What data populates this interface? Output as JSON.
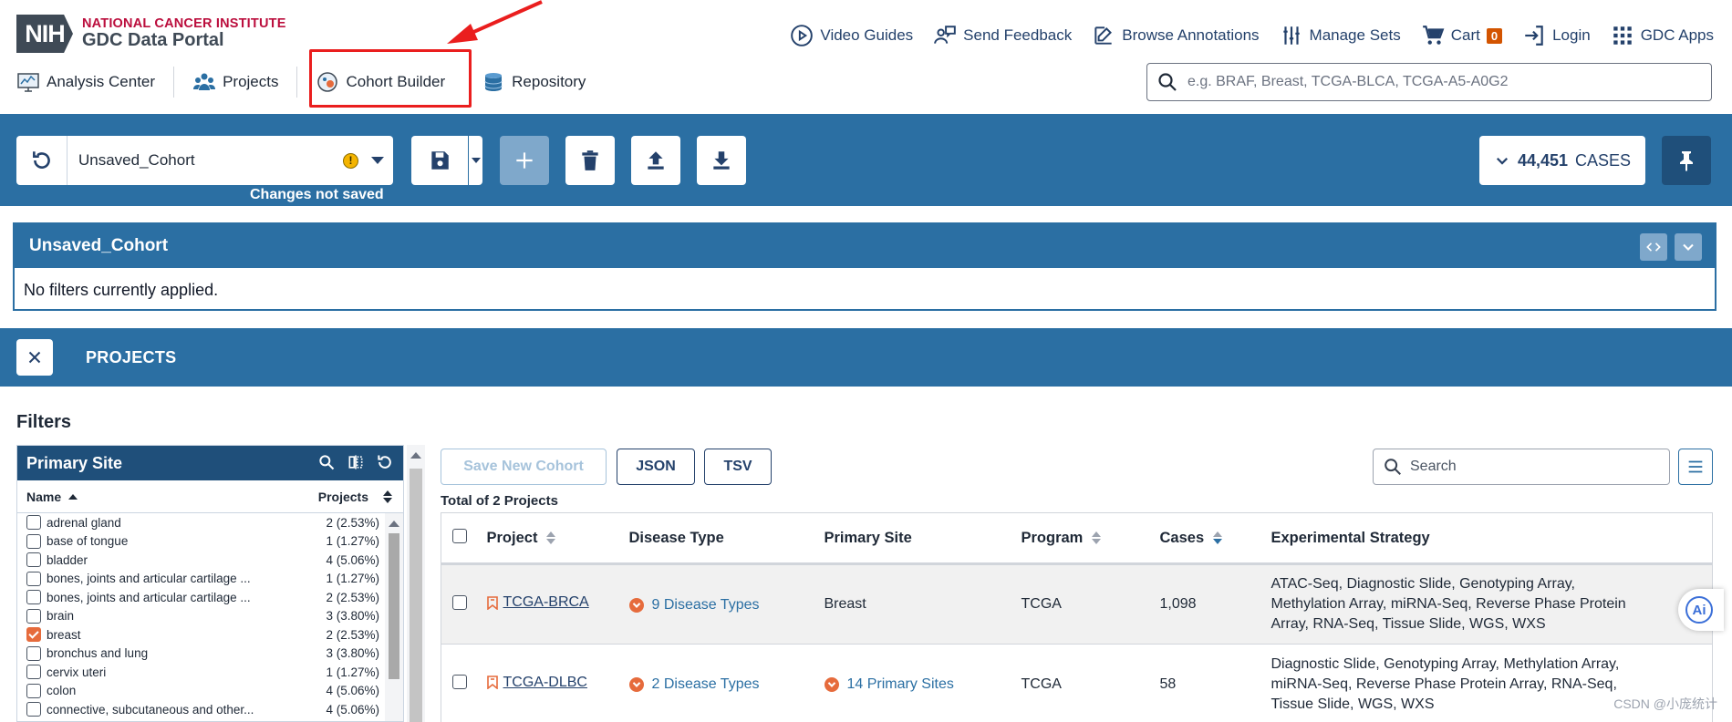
{
  "logo": {
    "badge": "NIH",
    "institute": "NATIONAL CANCER INSTITUTE",
    "portal": "GDC Data Portal"
  },
  "top_links": [
    {
      "label": "Video Guides",
      "icon": "play-circle-icon"
    },
    {
      "label": "Send Feedback",
      "icon": "feedback-icon"
    },
    {
      "label": "Browse Annotations",
      "icon": "edit-icon"
    },
    {
      "label": "Manage Sets",
      "icon": "sliders-icon"
    },
    {
      "label": "Cart",
      "icon": "cart-icon",
      "badge": "0"
    },
    {
      "label": "Login",
      "icon": "login-icon"
    },
    {
      "label": "GDC Apps",
      "icon": "apps-grid-icon"
    }
  ],
  "nav": [
    {
      "label": "Analysis Center",
      "icon": "analysis-center-icon"
    },
    {
      "label": "Projects",
      "icon": "projects-icon"
    },
    {
      "label": "Cohort Builder",
      "icon": "cohort-builder-icon"
    },
    {
      "label": "Repository",
      "icon": "repository-icon"
    }
  ],
  "search": {
    "placeholder": "e.g. BRAF, Breast, TCGA-BLCA, TCGA-A5-A0G2"
  },
  "cohort": {
    "name": "Unsaved_Cohort",
    "status": "Changes not saved",
    "cases_count": "44,451",
    "cases_label": "CASES"
  },
  "query": {
    "title": "Unsaved_Cohort",
    "empty_text": "No filters currently applied."
  },
  "projects_panel": {
    "title": "PROJECTS"
  },
  "filters": {
    "title": "Filters",
    "facet": {
      "title": "Primary Site",
      "col_name": "Name",
      "col_projects": "Projects",
      "items": [
        {
          "name": "adrenal gland",
          "count": "2 (2.53%)",
          "checked": false
        },
        {
          "name": "base of tongue",
          "count": "1 (1.27%)",
          "checked": false
        },
        {
          "name": "bladder",
          "count": "4 (5.06%)",
          "checked": false
        },
        {
          "name": "bones, joints and articular cartilage ...",
          "count": "1 (1.27%)",
          "checked": false
        },
        {
          "name": "bones, joints and articular cartilage ...",
          "count": "2 (2.53%)",
          "checked": false
        },
        {
          "name": "brain",
          "count": "3 (3.80%)",
          "checked": false
        },
        {
          "name": "breast",
          "count": "2 (2.53%)",
          "checked": true
        },
        {
          "name": "bronchus and lung",
          "count": "3 (3.80%)",
          "checked": false
        },
        {
          "name": "cervix uteri",
          "count": "1 (1.27%)",
          "checked": false
        },
        {
          "name": "colon",
          "count": "4 (5.06%)",
          "checked": false
        },
        {
          "name": "connective, subcutaneous and other...",
          "count": "4 (5.06%)",
          "checked": false
        }
      ]
    }
  },
  "table": {
    "buttons": {
      "save_new": "Save New Cohort",
      "json": "JSON",
      "tsv": "TSV"
    },
    "search_placeholder": "Search",
    "total_text": "Total of 2 Projects",
    "columns": [
      "Project",
      "Disease Type",
      "Primary Site",
      "Program",
      "Cases",
      "Experimental Strategy"
    ],
    "rows": [
      {
        "project": "TCGA-BRCA",
        "disease_type": "9 Disease Types",
        "primary_site": "Breast",
        "primary_site_expandable": false,
        "program": "TCGA",
        "cases": "1,098",
        "strategy": "ATAC-Seq, Diagnostic Slide, Genotyping Array, Methylation Array, miRNA-Seq, Reverse Phase Protein Array, RNA-Seq, Tissue Slide, WGS, WXS"
      },
      {
        "project": "TCGA-DLBC",
        "disease_type": "2 Disease Types",
        "primary_site": "14 Primary Sites",
        "primary_site_expandable": true,
        "program": "TCGA",
        "cases": "58",
        "strategy": "Diagnostic Slide, Genotyping Array, Methylation Array, miRNA-Seq, Reverse Phase Protein Array, RNA-Seq, Tissue Slide, WGS, WXS"
      }
    ]
  },
  "ai_button": {
    "label": "Ai"
  },
  "watermark": "CSDN @小庞统计",
  "colors": {
    "primary": "#2b6fa3",
    "dark": "#1f4f7a",
    "accent": "#e66b3c",
    "highlight": "#ea1e1e"
  }
}
